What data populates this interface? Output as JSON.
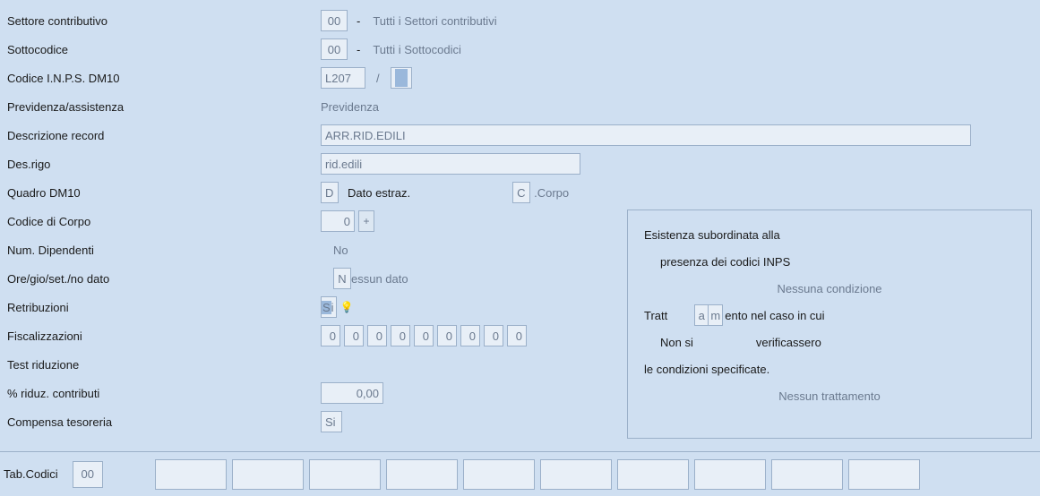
{
  "rows": {
    "settore": {
      "label": "Settore contributivo",
      "value": "00",
      "desc": "Tutti i Settori contributivi"
    },
    "sottocodice": {
      "label": "Sottocodice",
      "value": "00",
      "desc": "Tutti i Sottocodici"
    },
    "codiceinps": {
      "label": "Codice I.N.P.S. DM10",
      "value": "L207",
      "sep": "/"
    },
    "prev": {
      "label": "Previdenza/assistenza",
      "value": "Previdenza"
    },
    "descr": {
      "label": "Descrizione record",
      "value": "ARR.RID.EDILI"
    },
    "desrigo": {
      "label": "Des.rigo",
      "value": "rid.edili"
    },
    "quadro": {
      "label": "Quadro DM10",
      "v1": "D",
      "t1": "Dato estraz.",
      "v2": "C",
      "t2": ".Corpo"
    },
    "corpo": {
      "label": "Codice di Corpo",
      "value": "0",
      "plus": "+"
    },
    "numdip": {
      "label": "Num. Dipendenti",
      "value": "No"
    },
    "ore": {
      "label": "Ore/gio/set./no dato",
      "prefix": "N",
      "rest": "essun dato"
    },
    "retr": {
      "label": "Retribuzioni",
      "prefix": "S",
      "rest": "i",
      "icon": "💡"
    },
    "fisc": {
      "label": "Fiscalizzazioni",
      "values": [
        "0",
        "0",
        "0",
        "0",
        "0",
        "0",
        "0",
        "0",
        "0"
      ]
    },
    "testrid": {
      "label": "Test riduzione"
    },
    "pctrid": {
      "label": "% riduz. contributi",
      "value": "0,00"
    },
    "comptes": {
      "label": "Compensa tesoreria",
      "value": "Si"
    }
  },
  "side": {
    "l1": "Esistenza subordinata alla",
    "l2": "presenza dei codici INPS",
    "cond": "Nessuna condizione",
    "l3a": "Tratt",
    "cella": "a",
    "cellb": "m",
    "l3b": "ento nel caso in cui",
    "l4a": "Non si",
    "l4b": "verificassero",
    "l5": "le condizioni specificate.",
    "tratt": "Nessun trattamento"
  },
  "bottom": {
    "label": "Tab.Codici",
    "first": "00"
  }
}
